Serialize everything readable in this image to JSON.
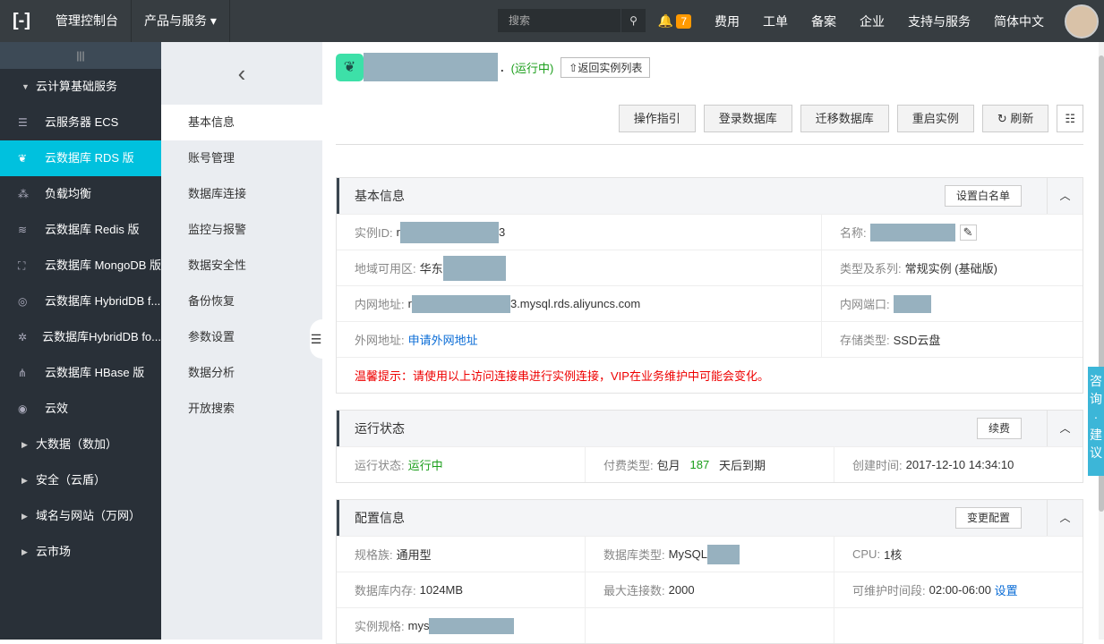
{
  "topbar": {
    "console": "管理控制台",
    "products": "产品与服务",
    "search_placeholder": "搜索",
    "notifications": "7",
    "items": [
      "费用",
      "工单",
      "备案",
      "企业",
      "支持与服务",
      "简体中文"
    ]
  },
  "sidebar": {
    "groups": [
      {
        "label": "云计算基础服务",
        "items": [
          "云服务器 ECS",
          "云数据库 RDS 版",
          "负载均衡",
          "云数据库 Redis 版",
          "云数据库 MongoDB 版",
          "云数据库 HybridDB f...",
          "云数据库HybridDB fo...",
          "云数据库 HBase 版",
          "云效"
        ]
      }
    ],
    "collapsed": [
      "大数据（数加）",
      "安全（云盾）",
      "域名与网站（万网）",
      "云市场"
    ],
    "active": "云数据库 RDS 版"
  },
  "subnav": {
    "items": [
      "基本信息",
      "账号管理",
      "数据库连接",
      "监控与报警",
      "数据安全性",
      "备份恢复",
      "参数设置",
      "数据分析",
      "开放搜索"
    ],
    "active": "基本信息"
  },
  "header": {
    "status": "(运行中)",
    "back": "返回实例列表",
    "buttons": [
      "操作指引",
      "登录数据库",
      "迁移数据库",
      "重启实例",
      "刷新"
    ]
  },
  "basic": {
    "title": "基本信息",
    "action": "设置白名单",
    "id_label": "实例ID:",
    "id_pre": "r",
    "id_suf": "3",
    "name_label": "名称:",
    "zone_label": "地域可用区:",
    "zone": "华东",
    "intranet_label": "内网地址:",
    "intranet_pre": "r",
    "intranet_suf": "3.mysql.rds.aliyuncs.com",
    "port_label": "内网端口:",
    "type_label": "类型及系列:",
    "type": "常规实例 (基础版)",
    "extranet_label": "外网地址:",
    "extranet_link": "申请外网地址",
    "storage_label": "存储类型:",
    "storage": "SSD云盘",
    "tip": "温馨提示：请使用以上访问连接串进行实例连接，VIP在业务维护中可能会变化。"
  },
  "running": {
    "title": "运行状态",
    "action": "续费",
    "state_label": "运行状态:",
    "state": "运行中",
    "pay_label": "付费类型:",
    "pay": "包月",
    "days": "187",
    "days_suffix": "天后到期",
    "created_label": "创建时间:",
    "created": "2017-12-10 14:34:10"
  },
  "config": {
    "title": "配置信息",
    "action": "变更配置",
    "family_label": "规格族:",
    "family": "通用型",
    "dbtype_label": "数据库类型:",
    "dbtype": "MySQL",
    "cpu_label": "CPU:",
    "cpu": "1核",
    "mem_label": "数据库内存:",
    "mem": "1024MB",
    "conn_label": "最大连接数:",
    "conn": "2000",
    "maint_label": "可维护时间段:",
    "maint": "02:00-06:00",
    "maint_link": "设置",
    "spec_label": "实例规格:",
    "spec_pre": "mys"
  },
  "float_btn": "咨询·建议",
  "colors": {
    "accent": "#00c1de",
    "running": "#1b9e1b",
    "warning": "#e00000",
    "link": "#0a6cd6"
  }
}
